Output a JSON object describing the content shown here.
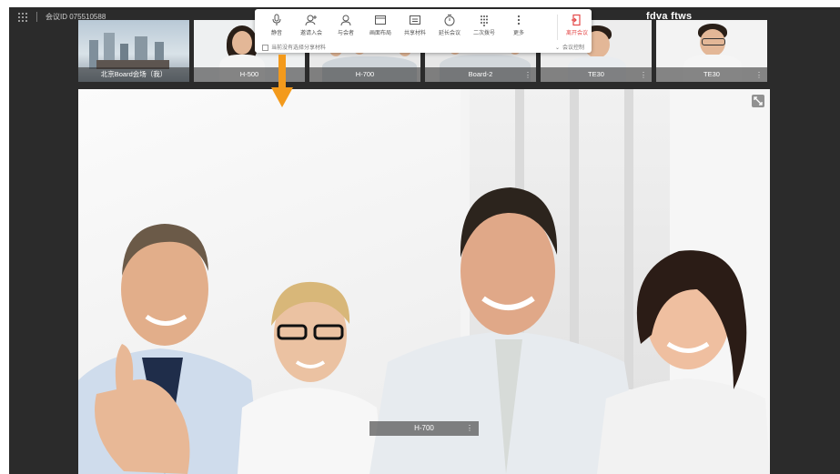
{
  "header": {
    "meeting_id": "会议ID 075510588",
    "brand_text": "fdva ftws"
  },
  "thumbnails": [
    {
      "label": "北京Board会场（我）"
    },
    {
      "label": "H-500"
    },
    {
      "label": "H-700"
    },
    {
      "label": "Board-2"
    },
    {
      "label": "TE30"
    },
    {
      "label": "TE30"
    }
  ],
  "toolbar": {
    "items": [
      {
        "label": "静音",
        "icon": "microphone-icon"
      },
      {
        "label": "邀请入会",
        "icon": "add-user-icon"
      },
      {
        "label": "与会者",
        "icon": "participants-icon"
      },
      {
        "label": "画面布局",
        "icon": "layout-icon"
      },
      {
        "label": "共享材料",
        "icon": "share-icon"
      },
      {
        "label": "延长会议",
        "icon": "timer-icon"
      },
      {
        "label": "二次拨号",
        "icon": "dialpad-icon"
      },
      {
        "label": "更多",
        "icon": "more-icon"
      },
      {
        "label": "离开会议",
        "icon": "exit-icon",
        "color": "#e44a4a"
      }
    ],
    "share_hint": "当前没有选择分享材料",
    "meeting_control": "会议控制"
  },
  "main_video": {
    "label": "H-700"
  },
  "colors": {
    "arrow": "#f39a1c",
    "danger": "#e44a4a",
    "app_bg": "#2b2b2b"
  }
}
